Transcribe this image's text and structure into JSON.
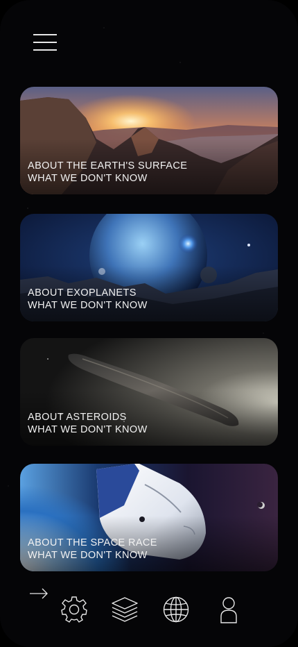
{
  "cards": [
    {
      "line1": "ABOUT THE EARTH'S SURFACE",
      "line2": "WHAT WE DON'T KNOW"
    },
    {
      "line1": "ABOUT EXOPLANETS",
      "line2": "WHAT WE DON'T KNOW"
    },
    {
      "line1": "ABOUT ASTEROIDS",
      "line2": "WHAT WE DON'T KNOW"
    },
    {
      "line1": "ABOUT THE SPACE RACE",
      "line2": "WHAT WE DON'T KNOW"
    }
  ],
  "icons": {
    "menu": "hamburger-menu-icon",
    "arrow": "arrow-right-icon",
    "nav": [
      "gear-icon",
      "layers-icon",
      "globe-icon",
      "user-icon"
    ]
  },
  "colors": {
    "background": "#000000",
    "text": "#f2f2f2",
    "icon": "#e8e8e8"
  }
}
